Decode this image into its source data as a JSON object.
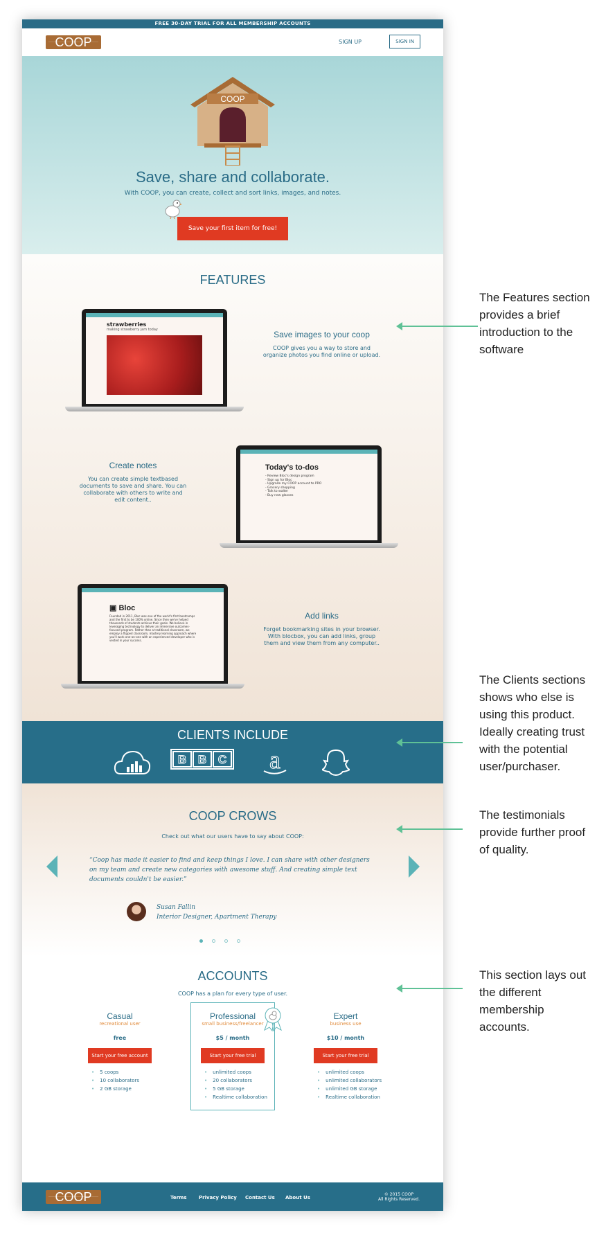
{
  "announcement": "FREE 30-DAY TRIAL FOR ALL MEMBERSHIP ACCOUNTS",
  "brand": "COOP",
  "nav": {
    "signup": "SIGN UP",
    "signin": "SIGN IN"
  },
  "hero": {
    "house_label": "COOP",
    "headline": "Save, share and collaborate.",
    "subtext": "With COOP, you can create, collect and sort links, images, and notes.",
    "cta": "Save your first item for free!"
  },
  "features": {
    "title": "FEATURES",
    "items": [
      {
        "title": "Save images to your coop",
        "text_lines": [
          "COOP gives you a way to store and",
          "organize photos you find online or upload."
        ],
        "screen_title": "strawberries",
        "screen_sub": "making strawberry jam today"
      },
      {
        "title": "Create notes",
        "text_lines": [
          "You can create simple textbased",
          "documents to save and share. You can",
          "collaborate with others to write and",
          "edit content.."
        ],
        "screen_title": "Today's to-dos",
        "todo": [
          "- Review Bloc's design program",
          "- Sign up for Bloc",
          "- Upgrade my COOP account to PRO",
          "- Grocery shopping",
          "- Talk to walter",
          "- Buy new glasses"
        ]
      },
      {
        "title": "Add links",
        "text_lines": [
          "Forget bookmarking sites in your browser.",
          "With blocbox, you can add links, group",
          "them and view them from any computer.."
        ],
        "screen_title": "Bloc",
        "screen_text": [
          "Founded in 2011, Bloc was one of the world's first bootcamps",
          "and the first to be 100% online. Since then we've helped",
          "thousands of students achieve their goals. We believe in",
          "leveraging technology to deliver an immersive outcomes-",
          "focused program. Rather than a traditional classroom, we",
          "employ a flipped classroom, mastery learning approach where",
          "you'll work one-on-one with an experienced developer who is",
          "vested in your success."
        ]
      }
    ]
  },
  "clients": {
    "title": "CLIENTS INCLUDE",
    "logos": [
      "cloud-analytics-icon",
      "bbc-logo",
      "amazon-logo",
      "snapchat-logo"
    ]
  },
  "testimonials": {
    "title": "COOP CROWS",
    "subtitle": "Check out what our users have to say about COOP:",
    "quote_lines": [
      "“Coop has made it easier to find and keep things I love. I can share with other designers",
      "on my team and create new categories with awesome stuff. And creating simple text",
      "documents couldn't be easier.”"
    ],
    "author": "Susan Fallin",
    "author_role": "Interior Designer, Apartment Therapy",
    "dots": 4,
    "active_dot": 0
  },
  "accounts": {
    "title": "ACCOUNTS",
    "subtitle": "COOP has a plan for every type of user.",
    "plans": [
      {
        "name": "Casual",
        "type": "recreational user",
        "price": "free",
        "button": "Start your free account",
        "features": [
          "5 coops",
          "10 collaborators",
          "2 GB storage"
        ]
      },
      {
        "name": "Professional",
        "type": "small business/freelancer",
        "price": "$5 / month",
        "button": "Start your free trial",
        "features": [
          "unlimited coops",
          "20 collaborators",
          "5 GB storage",
          "Realtime collaboration"
        ]
      },
      {
        "name": "Expert",
        "type": "business use",
        "price": "$10 / month",
        "button": "Start your free trial",
        "features": [
          "unlimited coops",
          "unlimited collaborators",
          "unlimited GB storage",
          "Realtime collaboration"
        ]
      }
    ]
  },
  "footer": {
    "links": [
      "Terms",
      "Privacy Policy",
      "Contact Us",
      "About Us"
    ],
    "copyright": "© 2015 COOP",
    "rights": "All Rights Reserved."
  },
  "annotations": [
    {
      "text_lines": [
        "The Features section",
        "provides a brief",
        "introduction to the",
        "software"
      ]
    },
    {
      "text_lines": [
        "The Clients sections",
        "shows who else is",
        "using this product.",
        "Ideally creating trust",
        "with the potential",
        "user/purchaser."
      ]
    },
    {
      "text_lines": [
        "The testimonials",
        "provide further proof",
        "of quality."
      ]
    },
    {
      "text_lines": [
        "This section lays out",
        "the different",
        "membership",
        "accounts."
      ]
    }
  ],
  "colors": {
    "brand_blue": "#2a6c87",
    "cta_red": "#e03a22",
    "wood": "#a86b34",
    "annotation_arrow": "#5fc196"
  }
}
